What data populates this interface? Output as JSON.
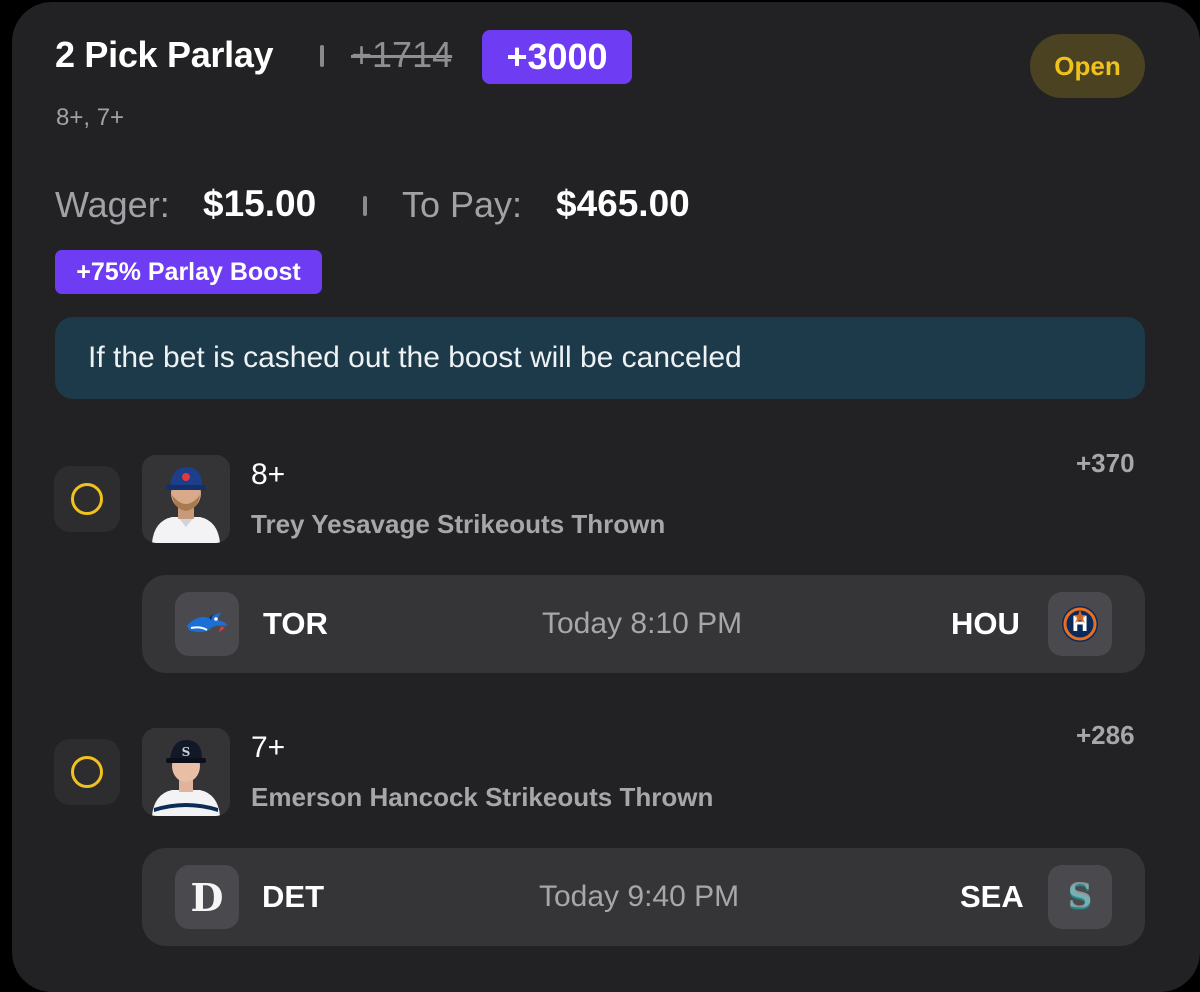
{
  "header": {
    "title": "2 Pick Parlay",
    "original_odds": "+1714",
    "boosted_odds": "+3000",
    "status": "Open",
    "subtitle": "8+, 7+"
  },
  "wager": {
    "wager_label": "Wager:",
    "wager_value": "$15.00",
    "pay_label": "To Pay:",
    "pay_value": "$465.00"
  },
  "boost_badge": "+75% Parlay Boost",
  "notice": "If the bet is cashed out the boost will be canceled",
  "legs": [
    {
      "line": "8+",
      "prop": "Trey Yesavage Strikeouts Thrown",
      "odds": "+370",
      "away_team": "TOR",
      "home_team": "HOU",
      "time": "Today 8:10 PM",
      "away_logo_icon": "blue-jays-logo-icon",
      "home_logo_icon": "astros-logo-icon"
    },
    {
      "line": "7+",
      "prop": "Emerson Hancock Strikeouts Thrown",
      "odds": "+286",
      "away_team": "DET",
      "home_team": "SEA",
      "time": "Today 9:40 PM",
      "away_logo_icon": "tigers-logo-icon",
      "home_logo_icon": "mariners-logo-icon"
    }
  ],
  "colors": {
    "accent_purple": "#6e3cf2",
    "status_yellow": "#f0c21e",
    "card_bg": "#222224",
    "notice_bg": "#1c3a4a"
  }
}
